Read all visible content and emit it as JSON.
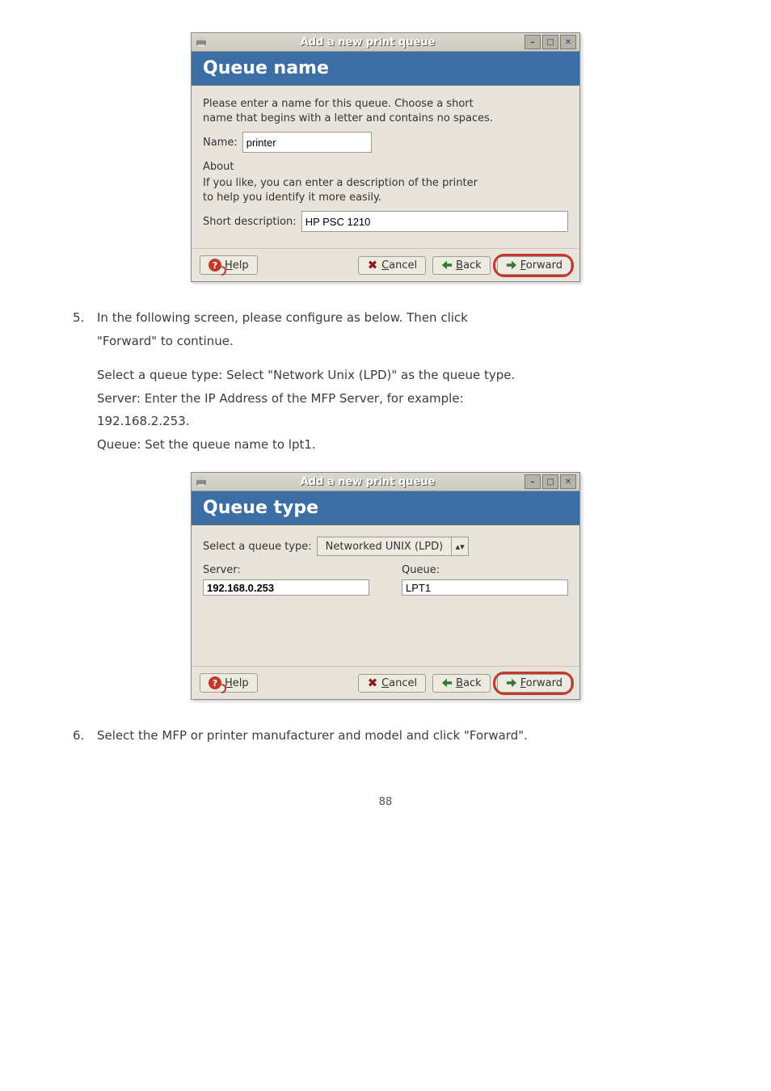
{
  "dialog1": {
    "title": "Add a new print queue",
    "banner": "Queue name",
    "para1_line1": "Please enter a name for this queue.  Choose a short",
    "para1_line2": "name that begins with a letter and contains no spaces.",
    "name_label": "Name:",
    "name_value": "printer",
    "about_heading": "About",
    "about_line1": "If you like, you can enter a description of the printer",
    "about_line2": "to help you identify it more easily.",
    "shortdesc_label": "Short description:",
    "shortdesc_value": "HP PSC 1210",
    "help_btn": "Help",
    "cancel_btn": "Cancel",
    "back_btn": "Back",
    "forward_btn": "Forward"
  },
  "step5": {
    "line1": "In the following screen, please configure as below. Then click",
    "line2": "\"Forward\" to continue.",
    "p_select": "Select a queue type: Select \"Network Unix (LPD)\" as the queue type.",
    "p_server": "Server: Enter the IP Address of the MFP Server, for example:",
    "p_server_ip": "192.168.2.253.",
    "p_queue": "Queue: Set the queue name to lpt1."
  },
  "dialog2": {
    "title": "Add a new print queue",
    "banner": "Queue type",
    "select_label": "Select a queue type:",
    "combo_text": "Networked UNIX (LPD)",
    "server_head": "Server:",
    "server_value": "192.168.0.253",
    "queue_head": "Queue:",
    "queue_value": "LPT1",
    "help_btn": "Help",
    "cancel_btn": "Cancel",
    "back_btn": "Back",
    "forward_btn": "Forward"
  },
  "step6": {
    "text": "Select the MFP or printer manufacturer and model and click \"Forward\"."
  },
  "page_number": "88"
}
